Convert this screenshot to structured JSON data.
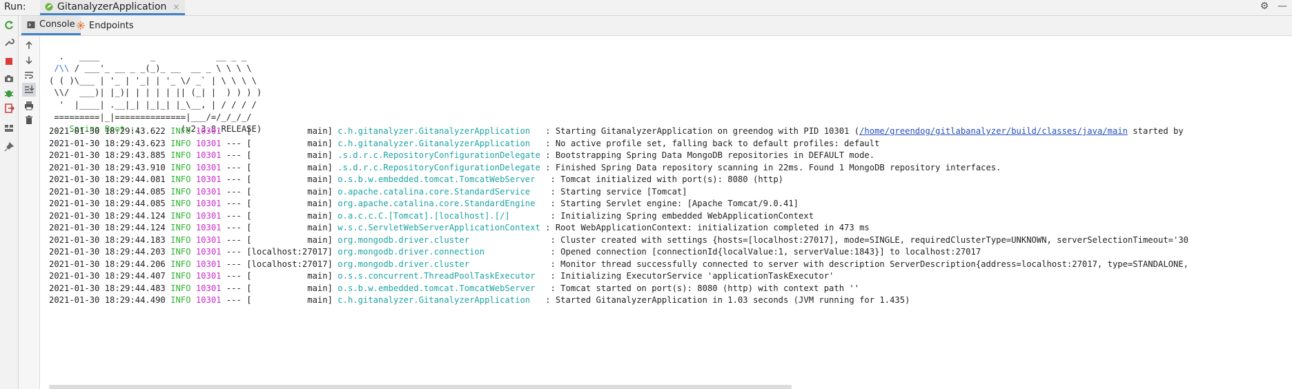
{
  "run": {
    "label": "Run:",
    "tab_name": "GitanalyzerApplication",
    "close": "×"
  },
  "toolbar_right": {
    "settings": "⚙",
    "minimize": "—"
  },
  "tabs": [
    {
      "label": "Console"
    },
    {
      "label": "Endpoints"
    }
  ],
  "banner": {
    "line1": "  .   ____          _            __ _ _",
    "line2_a": " /\\\\",
    "line2_b": " / ___'_ __ _ _(_)_ __  __ _ \\ \\ \\ \\",
    "line3": "( ( )\\___ | '_ | '_| | '_ \\/ _` | \\ \\ \\ \\",
    "line4": " \\\\/  ___)| |_)| | | | | || (_| |  ) ) ) )",
    "line5": "  '  |____| .__|_| |_|_| |_\\__, | / / / /",
    "line6": " =========|_|==============|___/=/_/_/_/",
    "spring": " :: Spring Boot :: ",
    "version": "       (v2.3.8.RELEASE)"
  },
  "log_lines": [
    {
      "ts": "2021-01-30 18:29:43.622",
      "level": "INFO",
      "pid": "10301",
      "sep": "---",
      "thread": "[           main]",
      "logger": "c.h.gitanalyzer.GitanalyzerApplication  ",
      "msg": ": Starting GitanalyzerApplication on greendog with PID 10301 (",
      "link": "/home/greendog/gitlabanalyzer/build/classes/java/main",
      "msg2": " started by"
    },
    {
      "ts": "2021-01-30 18:29:43.623",
      "level": "INFO",
      "pid": "10301",
      "sep": "---",
      "thread": "[           main]",
      "logger": "c.h.gitanalyzer.GitanalyzerApplication  ",
      "msg": ": No active profile set, falling back to default profiles: default",
      "link": "",
      "msg2": ""
    },
    {
      "ts": "2021-01-30 18:29:43.885",
      "level": "INFO",
      "pid": "10301",
      "sep": "---",
      "thread": "[           main]",
      "logger": ".s.d.r.c.RepositoryConfigurationDelegate",
      "msg": ": Bootstrapping Spring Data MongoDB repositories in DEFAULT mode.",
      "link": "",
      "msg2": ""
    },
    {
      "ts": "2021-01-30 18:29:43.910",
      "level": "INFO",
      "pid": "10301",
      "sep": "---",
      "thread": "[           main]",
      "logger": ".s.d.r.c.RepositoryConfigurationDelegate",
      "msg": ": Finished Spring Data repository scanning in 22ms. Found 1 MongoDB repository interfaces.",
      "link": "",
      "msg2": ""
    },
    {
      "ts": "2021-01-30 18:29:44.081",
      "level": "INFO",
      "pid": "10301",
      "sep": "---",
      "thread": "[           main]",
      "logger": "o.s.b.w.embedded.tomcat.TomcatWebServer  ",
      "msg": ": Tomcat initialized with port(s): 8080 (http)",
      "link": "",
      "msg2": ""
    },
    {
      "ts": "2021-01-30 18:29:44.085",
      "level": "INFO",
      "pid": "10301",
      "sep": "---",
      "thread": "[           main]",
      "logger": "o.apache.catalina.core.StandardService   ",
      "msg": ": Starting service [Tomcat]",
      "link": "",
      "msg2": ""
    },
    {
      "ts": "2021-01-30 18:29:44.085",
      "level": "INFO",
      "pid": "10301",
      "sep": "---",
      "thread": "[           main]",
      "logger": "org.apache.catalina.core.StandardEngine  ",
      "msg": ": Starting Servlet engine: [Apache Tomcat/9.0.41]",
      "link": "",
      "msg2": ""
    },
    {
      "ts": "2021-01-30 18:29:44.124",
      "level": "INFO",
      "pid": "10301",
      "sep": "---",
      "thread": "[           main]",
      "logger": "o.a.c.c.C.[Tomcat].[localhost].[/]       ",
      "msg": ": Initializing Spring embedded WebApplicationContext",
      "link": "",
      "msg2": ""
    },
    {
      "ts": "2021-01-30 18:29:44.124",
      "level": "INFO",
      "pid": "10301",
      "sep": "---",
      "thread": "[           main]",
      "logger": "w.s.c.ServletWebServerApplicationContext",
      "msg": ": Root WebApplicationContext: initialization completed in 473 ms",
      "link": "",
      "msg2": ""
    },
    {
      "ts": "2021-01-30 18:29:44.183",
      "level": "INFO",
      "pid": "10301",
      "sep": "---",
      "thread": "[           main]",
      "logger": "org.mongodb.driver.cluster               ",
      "msg": ": Cluster created with settings {hosts=[localhost:27017], mode=SINGLE, requiredClusterType=UNKNOWN, serverSelectionTimeout='30",
      "link": "",
      "msg2": ""
    },
    {
      "ts": "2021-01-30 18:29:44.203",
      "level": "INFO",
      "pid": "10301",
      "sep": "---",
      "thread": "[localhost:27017]",
      "logger": "org.mongodb.driver.connection            ",
      "msg": ": Opened connection [connectionId{localValue:1, serverValue:1843}] to localhost:27017",
      "link": "",
      "msg2": ""
    },
    {
      "ts": "2021-01-30 18:29:44.206",
      "level": "INFO",
      "pid": "10301",
      "sep": "---",
      "thread": "[localhost:27017]",
      "logger": "org.mongodb.driver.cluster               ",
      "msg": ": Monitor thread successfully connected to server with description ServerDescription{address=localhost:27017, type=STANDALONE,",
      "link": "",
      "msg2": ""
    },
    {
      "ts": "2021-01-30 18:29:44.407",
      "level": "INFO",
      "pid": "10301",
      "sep": "---",
      "thread": "[           main]",
      "logger": "o.s.s.concurrent.ThreadPoolTaskExecutor  ",
      "msg": ": Initializing ExecutorService 'applicationTaskExecutor'",
      "link": "",
      "msg2": ""
    },
    {
      "ts": "2021-01-30 18:29:44.483",
      "level": "INFO",
      "pid": "10301",
      "sep": "---",
      "thread": "[           main]",
      "logger": "o.s.b.w.embedded.tomcat.TomcatWebServer  ",
      "msg": ": Tomcat started on port(s): 8080 (http) with context path ''",
      "link": "",
      "msg2": ""
    },
    {
      "ts": "2021-01-30 18:29:44.490",
      "level": "INFO",
      "pid": "10301",
      "sep": "---",
      "thread": "[           main]",
      "logger": "c.h.gitanalyzer.GitanalyzerApplication  ",
      "msg": ": Started GitanalyzerApplication in 1.03 seconds (JVM running for 1.435)",
      "link": "",
      "msg2": ""
    }
  ],
  "colors": {
    "info": "#2fb22f",
    "pid": "#c92bc9",
    "logger": "#1ea3a3",
    "link": "#2650b8",
    "accent": "#4083c9"
  }
}
